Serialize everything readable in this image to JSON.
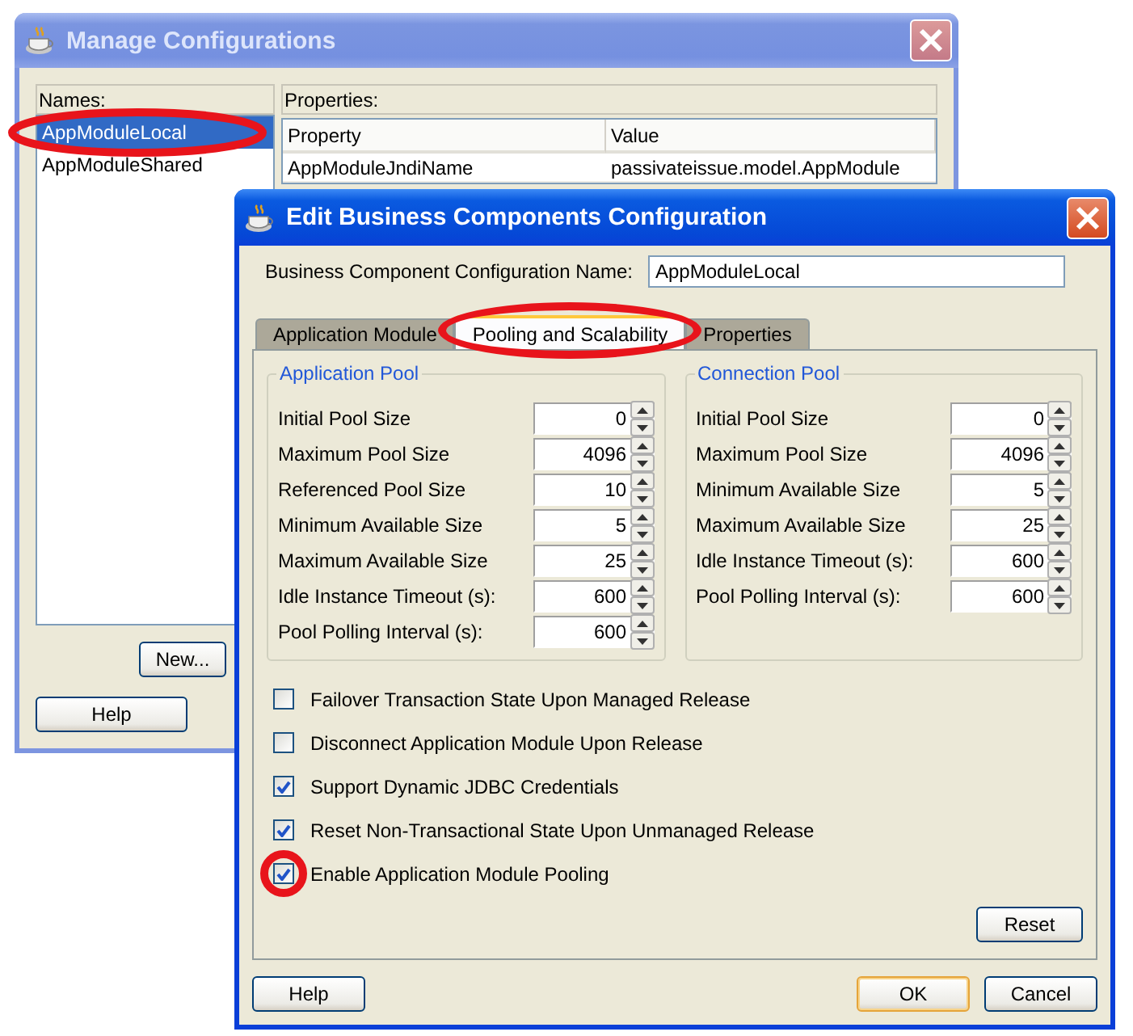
{
  "manage_window": {
    "title": "Manage Configurations",
    "names_label": "Names:",
    "names": [
      {
        "label": "AppModuleLocal",
        "selected": true,
        "circled": true
      },
      {
        "label": "AppModuleShared",
        "selected": false,
        "circled": false
      }
    ],
    "properties_label": "Properties:",
    "properties_table": {
      "columns": [
        "Property",
        "Value"
      ],
      "rows": [
        [
          "AppModuleJndiName",
          "passivateissue.model.AppModule"
        ]
      ]
    },
    "buttons": [
      "New...",
      "Help"
    ]
  },
  "edit_window": {
    "title": "Edit Business Components Configuration",
    "name_label": "Business Component Configuration Name:",
    "name_value": "AppModuleLocal",
    "tabs": [
      {
        "label": "Application Module",
        "selected": false,
        "circled": false
      },
      {
        "label": "Pooling and Scalability",
        "selected": true,
        "circled": true
      },
      {
        "label": "Properties",
        "selected": false,
        "circled": false
      }
    ],
    "groups": [
      {
        "title": "Application Pool",
        "fields": [
          {
            "label": "Initial Pool Size",
            "value": "0"
          },
          {
            "label": "Maximum Pool Size",
            "value": "4096"
          },
          {
            "label": "Referenced Pool Size",
            "value": "10"
          },
          {
            "label": "Minimum Available Size",
            "value": "5"
          },
          {
            "label": "Maximum Available Size",
            "value": "25"
          },
          {
            "label": "Idle Instance Timeout (s):",
            "value": "600"
          },
          {
            "label": "Pool Polling Interval (s):",
            "value": "600"
          }
        ]
      },
      {
        "title": "Connection Pool",
        "fields": [
          {
            "label": "Initial Pool Size",
            "value": "0"
          },
          {
            "label": "Maximum Pool Size",
            "value": "4096"
          },
          {
            "label": "Minimum Available Size",
            "value": "5"
          },
          {
            "label": "Maximum Available Size",
            "value": "25"
          },
          {
            "label": "Idle Instance Timeout (s):",
            "value": "600"
          },
          {
            "label": "Pool Polling Interval (s):",
            "value": "600"
          }
        ]
      }
    ],
    "options": [
      {
        "label": "Failover Transaction State Upon Managed Release",
        "checked": false,
        "circled": false
      },
      {
        "label": "Disconnect Application Module Upon Release",
        "checked": false,
        "circled": false
      },
      {
        "label": "Support Dynamic JDBC Credentials",
        "checked": true,
        "circled": false
      },
      {
        "label": "Reset Non-Transactional State Upon Unmanaged Release",
        "checked": true,
        "circled": false
      },
      {
        "label": "Enable Application Module Pooling",
        "checked": true,
        "circled": true
      }
    ],
    "reset_button": "Reset",
    "buttons": [
      {
        "label": "Help",
        "default": false
      },
      {
        "label": "OK",
        "default": true
      },
      {
        "label": "Cancel",
        "default": false
      }
    ]
  }
}
